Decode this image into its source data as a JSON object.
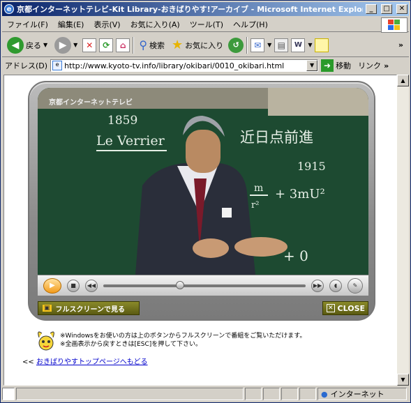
{
  "window": {
    "title": "京都インターネットテレビ-Kit Library-おきばりやす!アーカイブ - Microsoft Internet Explorer",
    "min_label": "_",
    "max_label": "□",
    "close_label": "✕"
  },
  "menu": [
    "ファイル(F)",
    "編集(E)",
    "表示(V)",
    "お気に入り(A)",
    "ツール(T)",
    "ヘルプ(H)"
  ],
  "toolbar": {
    "back_label": "戻る",
    "search_label": "検索",
    "favorites_label": "お気に入り"
  },
  "address": {
    "label": "アドレス(D)",
    "url": "http://www.kyoto-tv.info/library/okibari/0010_okibari.html",
    "go_label": "移動",
    "links_label": "リンク"
  },
  "player": {
    "channel": "京都インターネットテレビ",
    "progress": 0.36,
    "fullscreen_label": "フルスクリーンで見る",
    "close_label": "CLOSE",
    "board_text": {
      "year1": "1859",
      "name": "Le Verrier",
      "kanji": "近日点前進",
      "year2": "1915",
      "eq1": "m",
      "eq2": "r²",
      "eq3": "+ 3mU²",
      "eq4": "+ 0"
    }
  },
  "notes": {
    "line1": "※Windowsをお使いの方は上のボタンからフルスクリーンで番組をご覧いただけます。",
    "line2": "※全画表示から戻すときは[ESC]を押して下さい。"
  },
  "back": {
    "prefix": "<<",
    "link": "おきばりやすトップページへもどる"
  },
  "status": {
    "zone": "インターネット"
  }
}
